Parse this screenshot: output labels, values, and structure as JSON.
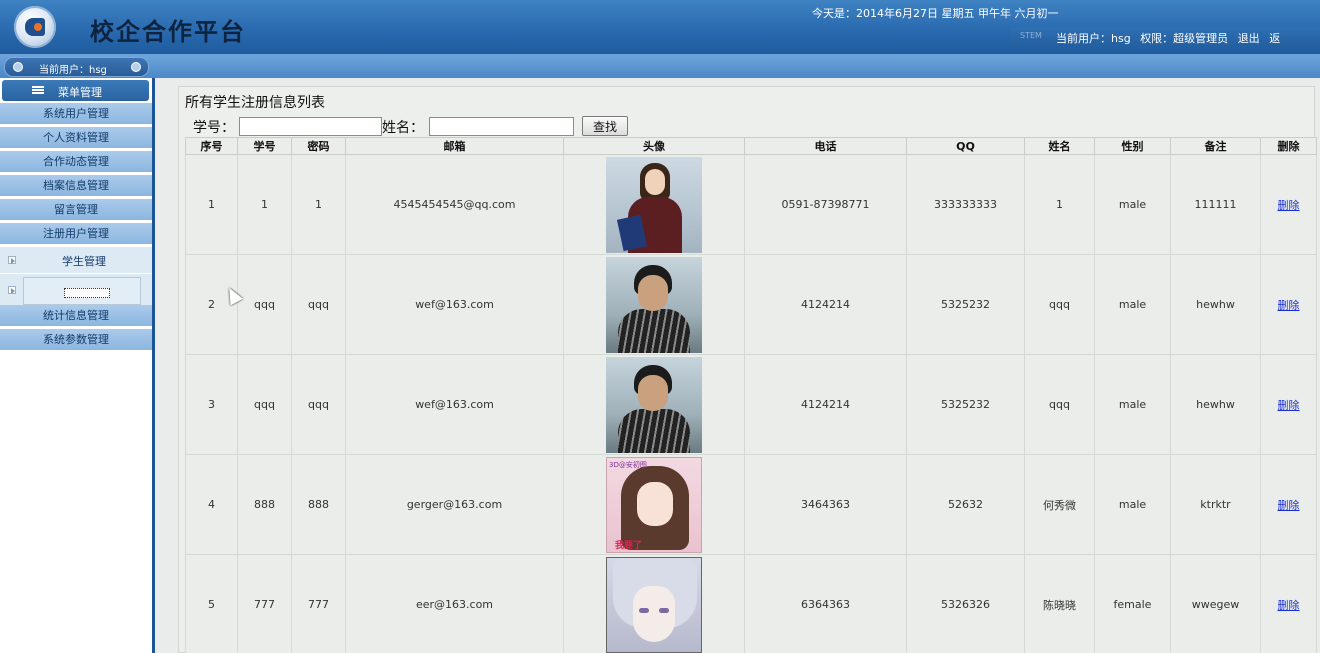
{
  "header": {
    "title": "校企合作平台",
    "date_line": "今天是：2014年6月27日 星期五 甲午年 六月初一",
    "sys_text": "STEM",
    "current_user": "当前用户：hsg",
    "permission": "权限：超级管理员",
    "logout": "退出",
    "extra": "返"
  },
  "subbar": {
    "current_user": "当前用户：hsg"
  },
  "sidebar": {
    "menu_title": "菜单管理",
    "items": [
      {
        "label": "系统用户管理"
      },
      {
        "label": "个人资料管理"
      },
      {
        "label": "合作动态管理"
      },
      {
        "label": "档案信息管理"
      },
      {
        "label": "留言管理"
      },
      {
        "label": "注册用户管理"
      }
    ],
    "sub_item": "学生管理",
    "items_after": [
      {
        "label": "统计信息管理"
      },
      {
        "label": "系统参数管理"
      }
    ]
  },
  "main": {
    "title": "所有学生注册信息列表",
    "search": {
      "id_label": "学号：",
      "id_value": "",
      "name_label": "姓名：",
      "name_value": "",
      "button": "查找"
    },
    "columns": [
      "序号",
      "学号",
      "密码",
      "邮箱",
      "头像",
      "电话",
      "QQ",
      "姓名",
      "性别",
      "备注",
      "删除"
    ],
    "rows": [
      {
        "no": "1",
        "sid": "1",
        "pwd": "1",
        "email": "4545454545@qq.com",
        "avatar": "woman-photo",
        "phone": "0591-87398771",
        "qq": "333333333",
        "name": "1",
        "gender": "male",
        "note": "111111",
        "del": "删除"
      },
      {
        "no": "2",
        "sid": "qqq",
        "pwd": "qqq",
        "email": "wef@163.com",
        "avatar": "man-photo",
        "phone": "4124214",
        "qq": "5325232",
        "name": "qqq",
        "gender": "male",
        "note": "hewhw",
        "del": "删除"
      },
      {
        "no": "3",
        "sid": "qqq",
        "pwd": "qqq",
        "email": "wef@163.com",
        "avatar": "man-photo",
        "phone": "4124214",
        "qq": "5325232",
        "name": "qqq",
        "gender": "male",
        "note": "hewhw",
        "del": "删除"
      },
      {
        "no": "4",
        "sid": "888",
        "pwd": "888",
        "email": "gerger@163.com",
        "avatar": "anime-girl",
        "phone": "3464363",
        "qq": "52632",
        "name": "何秀微",
        "gender": "male",
        "note": "ktrktr",
        "del": "删除"
      },
      {
        "no": "5",
        "sid": "777",
        "pwd": "777",
        "email": "eer@163.com",
        "avatar": "anime-boy",
        "phone": "6364363",
        "qq": "5326326",
        "name": "陈晓晓",
        "gender": "female",
        "note": "wwegew",
        "del": "删除"
      }
    ],
    "avatar4_top": "3D@安初图",
    "avatar4_bottom": "我要了"
  },
  "colors": {
    "header_blue": "#2a6aaf",
    "sidebar_item": "#aacbea",
    "link": "#1a2fd6"
  }
}
